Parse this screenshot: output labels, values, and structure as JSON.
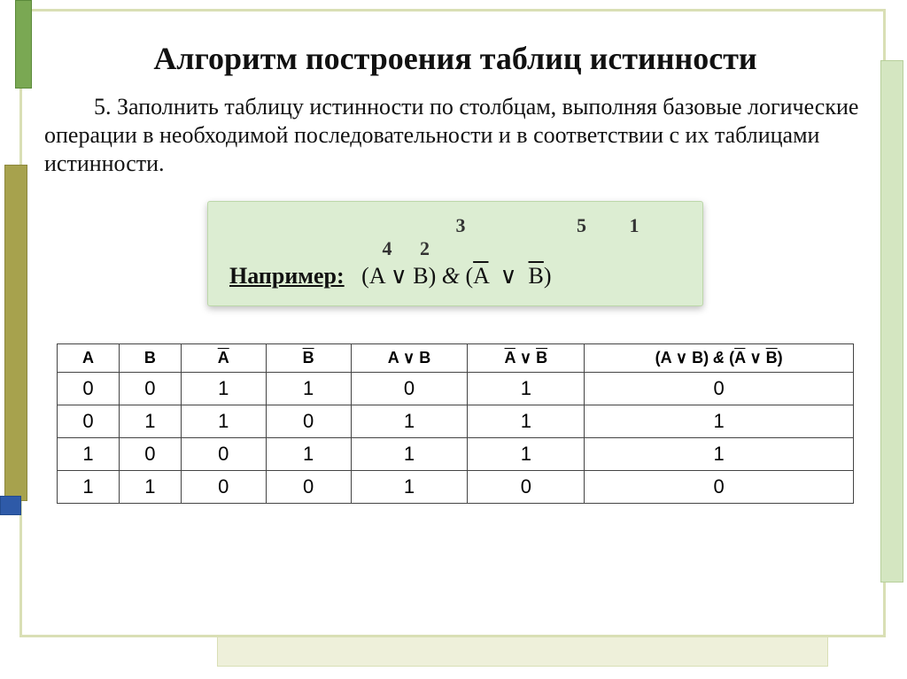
{
  "title": "Алгоритм построения таблиц истинности",
  "paragraph": "5. Заполнить таблицу истинности по столбцам, выполняя базовые логические операции в необходимой последовательности и в соответствии с их таблицами истинности.",
  "example": {
    "order_numbers": [
      "3",
      "5",
      "1",
      "4",
      "2"
    ],
    "label": "Например:",
    "lp": "(",
    "A": "A",
    "or": "∨",
    "B": "B",
    "rp": ")",
    "amp": "&",
    "A2": "A",
    "B2": "B"
  },
  "table": {
    "headers": {
      "h0": "A",
      "h1": "B",
      "h2_over": "A",
      "h3_over": "B",
      "h4_plain": "A ∨ B",
      "h5_pre_over": "A",
      "h5_mid": " ∨ ",
      "h5_post_over": "B",
      "h6_pre": "(A ∨ B) ",
      "h6_amp": "& ",
      "h6_open": "(",
      "h6_over1": "A",
      "h6_mid": "  ∨  ",
      "h6_over2": "B",
      "h6_close": ")"
    },
    "rows": [
      [
        "0",
        "0",
        "1",
        "1",
        "0",
        "1",
        "0"
      ],
      [
        "0",
        "1",
        "1",
        "0",
        "1",
        "1",
        "1"
      ],
      [
        "1",
        "0",
        "0",
        "1",
        "1",
        "1",
        "1"
      ],
      [
        "1",
        "1",
        "0",
        "0",
        "1",
        "0",
        "0"
      ]
    ]
  },
  "chart_data": {
    "type": "table",
    "title": "Truth table for (A ∨ B) & (¬A ∨ ¬B)",
    "columns": [
      "A",
      "B",
      "¬A",
      "¬B",
      "A∨B",
      "¬A∨¬B",
      "(A∨B)&(¬A∨¬B)"
    ],
    "rows": [
      [
        0,
        0,
        1,
        1,
        0,
        1,
        0
      ],
      [
        0,
        1,
        1,
        0,
        1,
        1,
        1
      ],
      [
        1,
        0,
        0,
        1,
        1,
        1,
        1
      ],
      [
        1,
        1,
        0,
        0,
        1,
        0,
        0
      ]
    ]
  }
}
